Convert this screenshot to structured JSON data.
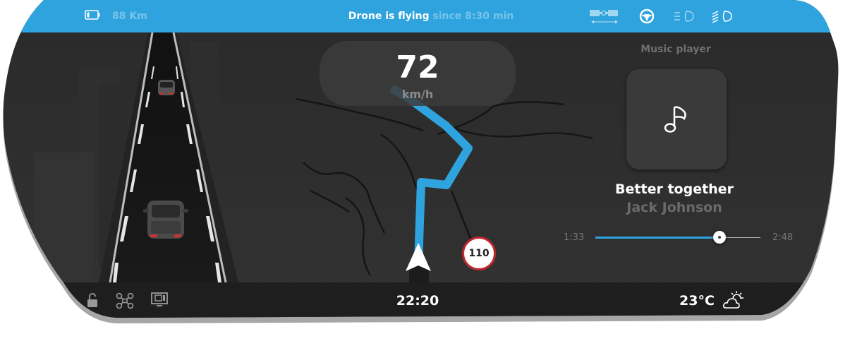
{
  "top_bar": {
    "range": "88 Km",
    "drone_status_main": "Drone is flying",
    "drone_status_sub": " since 8:30 min",
    "icons": [
      "battery-icon",
      "trailer-icon",
      "steering-wheel-icon",
      "low-beam-icon",
      "high-beam-icon"
    ]
  },
  "speed": {
    "value": "72",
    "unit": "km/h"
  },
  "music": {
    "title": "Music player",
    "song": "Better together",
    "artist": "Jack Johnson",
    "elapsed": "1:33",
    "total": "2:48",
    "progress_fraction": 0.75,
    "icon": "music-note-icon"
  },
  "speed_limit": "110",
  "bottom_bar": {
    "clock": "22:20",
    "temperature": "23°C",
    "icons": [
      "lock-icon",
      "drone-icon",
      "camera-screen-icon",
      "weather-partly-cloudy-icon"
    ]
  },
  "colors": {
    "accent": "#2fa3de",
    "background": "#2b2b2b",
    "bar": "#1e1e1e",
    "limit_red": "#c0272d"
  }
}
